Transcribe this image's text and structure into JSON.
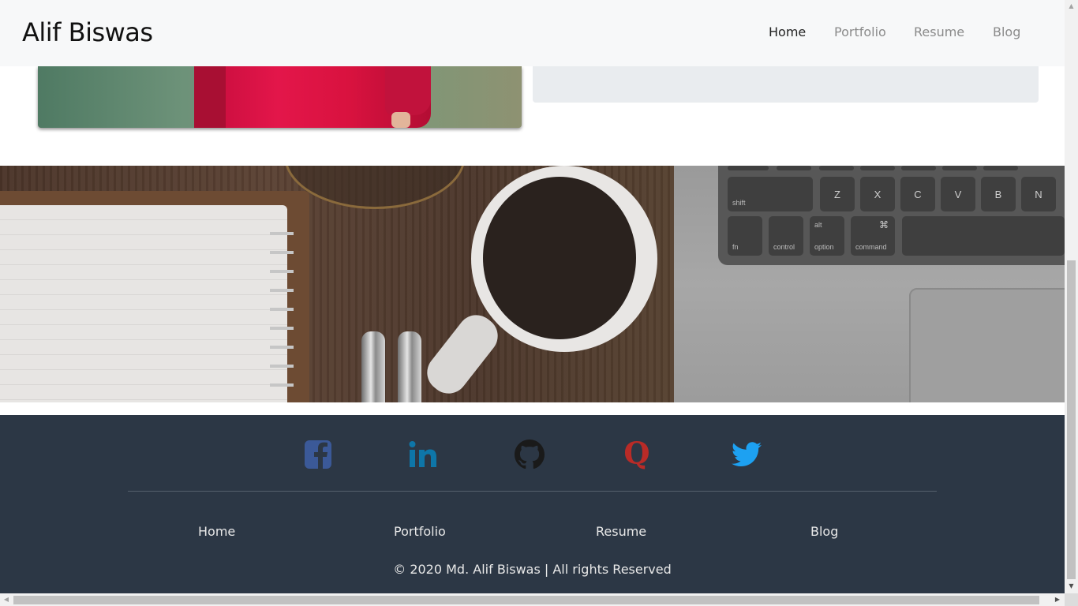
{
  "navbar": {
    "brand": "Alif Biswas",
    "links": [
      {
        "label": "Home",
        "active": true
      },
      {
        "label": "Portfolio",
        "active": false
      },
      {
        "label": "Resume",
        "active": false
      },
      {
        "label": "Blog",
        "active": false
      }
    ]
  },
  "banner": {
    "keys": {
      "z": "Z",
      "x": "X",
      "c": "C",
      "v": "V",
      "b": "B",
      "n": "N",
      "shift": "shift",
      "fn": "fn",
      "control": "control",
      "option": "option",
      "option_alt": "alt",
      "command": "command",
      "command_symbol": "⌘"
    }
  },
  "footer": {
    "social": [
      {
        "name": "facebook-icon",
        "color": "#3b5998"
      },
      {
        "name": "linkedin-icon",
        "color": "#0e76a8"
      },
      {
        "name": "github-icon",
        "color": "#1a1a1a"
      },
      {
        "name": "quora-icon",
        "color": "#b92b27"
      },
      {
        "name": "twitter-icon",
        "color": "#1da1f2"
      }
    ],
    "links": [
      "Home",
      "Portfolio",
      "Resume",
      "Blog"
    ],
    "copyright": "© 2020 Md. Alif Biswas | All rights Reserved"
  },
  "colors": {
    "navbar_bg": "#f7f8f9",
    "footer_bg": "#2c3745",
    "card_bg": "#e9ecef"
  }
}
